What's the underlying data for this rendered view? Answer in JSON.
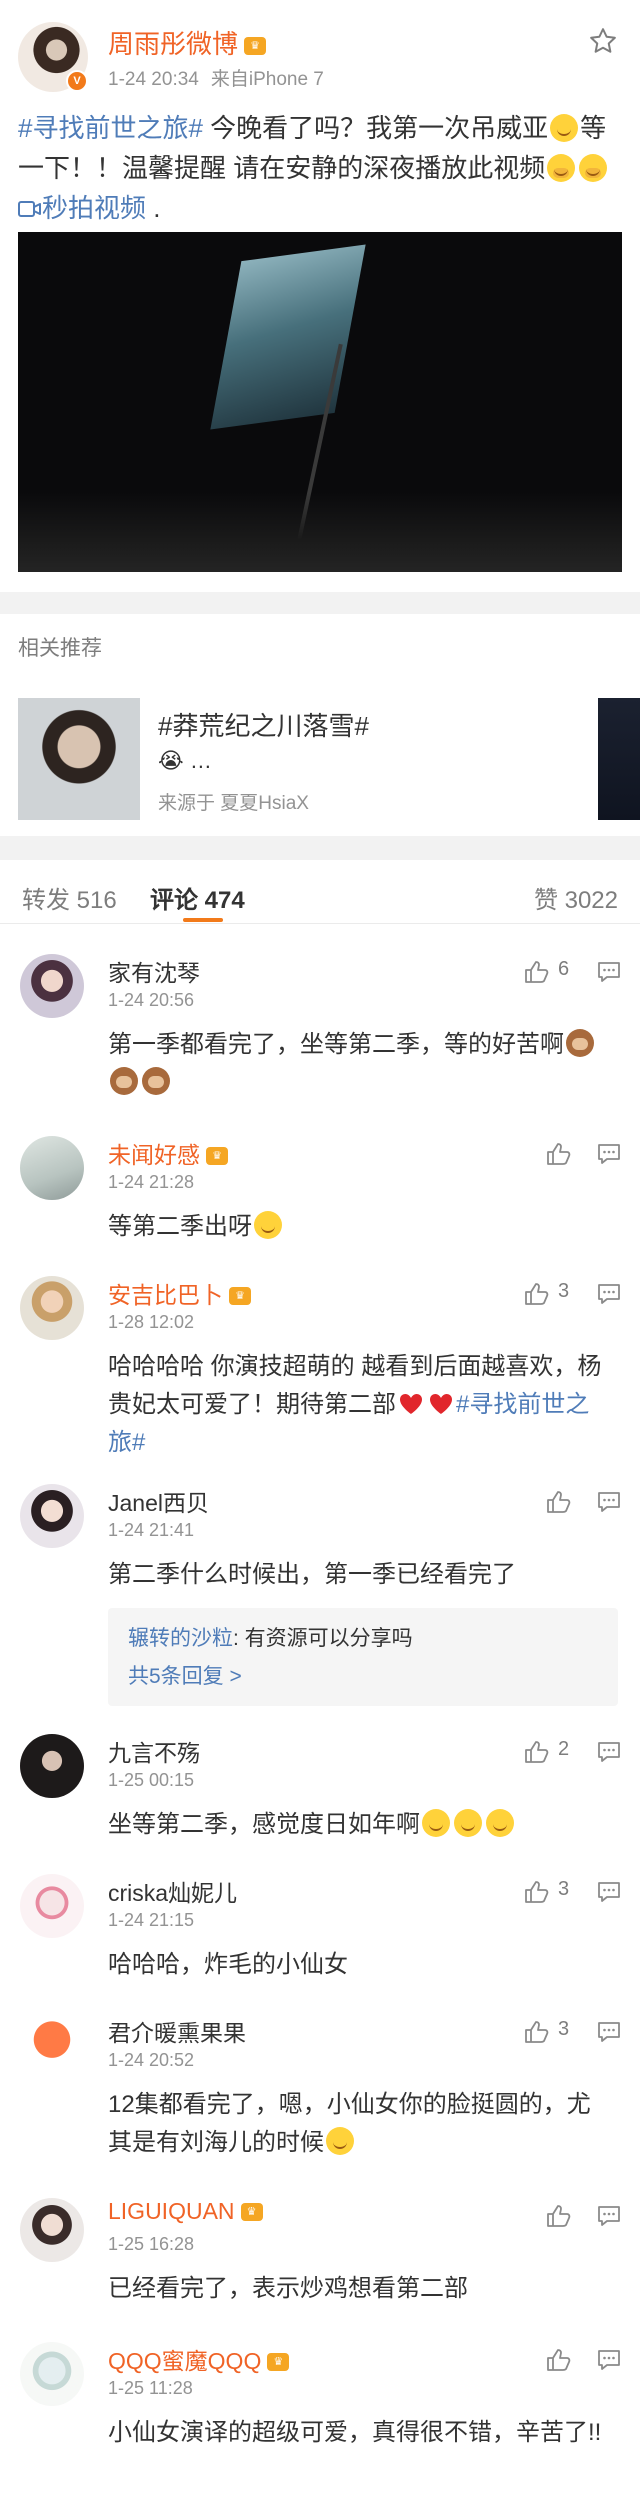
{
  "post": {
    "user": "周雨彤微博",
    "time": "1-24 20:34",
    "source": "来自iPhone 7",
    "hashtag": "#寻找前世之旅#",
    "text_1": " 今晚看了吗？我第一次吊威亚",
    "text_2": "等一下！！温馨提醒 请在安静的深夜播放此视频",
    "video_link": "秒拍视频",
    "text_end": " ."
  },
  "related": {
    "title": "相关推荐",
    "topic": "#莽荒纪之川落雪#",
    "emojis": "😭 …",
    "source": "来源于 夏夏HsiaX"
  },
  "tabs": {
    "repost": "转发 516",
    "comment": "评论 474",
    "like": "赞 3022"
  },
  "comments": [
    {
      "user": "家有沈琴",
      "time": "1-24 20:56",
      "text": "第一季都看完了，坐等第二季，等的好苦啊",
      "likes": "6"
    },
    {
      "user": "未闻好感",
      "time": "1-24 21:28",
      "text": "等第二季出呀",
      "likes": ""
    },
    {
      "user": "安吉比巴卜",
      "time": "1-28 12:02",
      "text": "哈哈哈哈 你演技超萌的 越看到后面越喜欢，杨贵妃太可爱了！期待第二部",
      "hashtag": "#寻找前世之旅#",
      "likes": "3"
    },
    {
      "user": "Janel西贝",
      "time": "1-24 21:41",
      "text": "第二季什么时候出，第一季已经看完了",
      "likes": "",
      "reply": {
        "user": "辗转的沙粒",
        "text": ": 有资源可以分享吗",
        "more": "共5条回复 >"
      }
    },
    {
      "user": "九言不殇",
      "time": "1-25 00:15",
      "text": "坐等第二季，感觉度日如年啊",
      "likes": "2"
    },
    {
      "user": "criska灿妮儿",
      "time": "1-24 21:15",
      "text": "哈哈哈，炸毛的小仙女",
      "likes": "3"
    },
    {
      "user": "君介暖熏果果",
      "time": "1-24 20:52",
      "text": "12集都看完了，嗯，小仙女你的脸挺圆的，尤其是有刘海儿的时候",
      "likes": "3"
    },
    {
      "user": "LIGUIQUAN",
      "time": "1-25 16:28",
      "text": "已经看完了，表示炒鸡想看第二部",
      "likes": ""
    },
    {
      "user": "QQQ蜜魔QQQ",
      "time": "1-25 11:28",
      "text": "小仙女演译的超级可爱，真得很不错，辛苦了!!",
      "likes": ""
    }
  ],
  "colors": {
    "accent": "#f27a1a",
    "link": "#4f7cb8",
    "vip_name": "#f06326"
  },
  "icons": [
    "star-icon",
    "thumb-up-icon",
    "reply-icon",
    "verified-badge-icon",
    "vip-crown-icon"
  ]
}
